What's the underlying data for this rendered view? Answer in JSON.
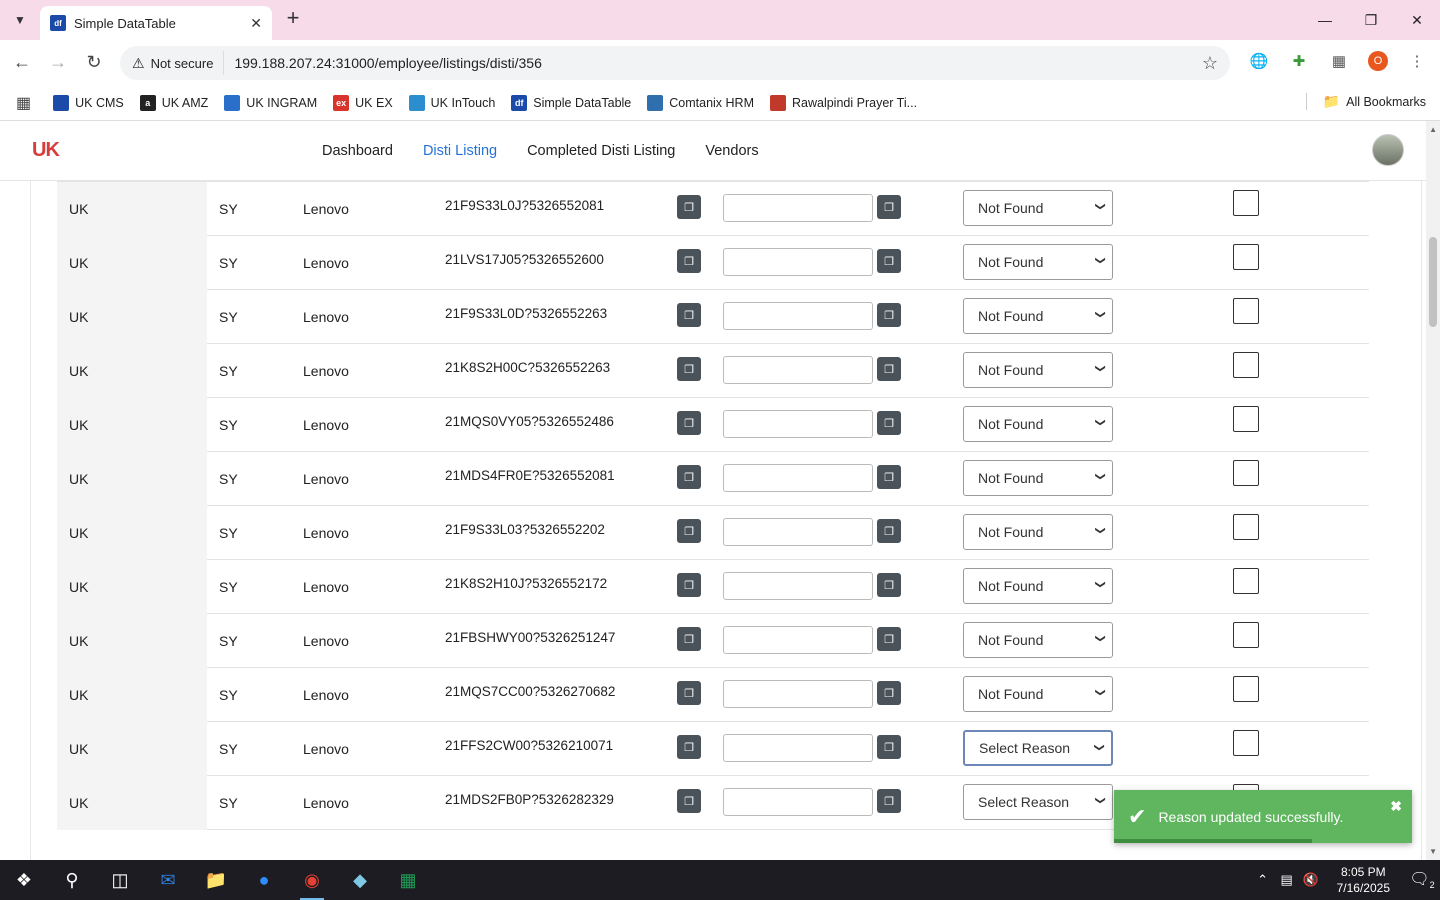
{
  "browser": {
    "tab_title": "Simple DataTable",
    "tab_favicon": "df",
    "not_secure": "Not secure",
    "url": "199.188.207.24:31000/employee/listings/disti/356",
    "profile_initial": "O",
    "bookmarks": [
      {
        "label": "UK CMS",
        "icon": "",
        "color": "#1b4aa8"
      },
      {
        "label": "UK AMZ",
        "icon": "a",
        "color": "#222222"
      },
      {
        "label": "UK INGRAM",
        "icon": "",
        "color": "#2a6fc9"
      },
      {
        "label": "UK EX",
        "icon": "ex",
        "color": "#d9342b"
      },
      {
        "label": "UK InTouch",
        "icon": "",
        "color": "#2c8ecf"
      },
      {
        "label": "Simple DataTable",
        "icon": "df",
        "color": "#1b4aa8"
      },
      {
        "label": "Comtanix HRM",
        "icon": "",
        "color": "#2f6fad"
      },
      {
        "label": "Rawalpindi Prayer Ti...",
        "icon": "",
        "color": "#c0392b"
      }
    ],
    "all_bookmarks": "All Bookmarks"
  },
  "site": {
    "logo_text": "UK",
    "nav": [
      "Dashboard",
      "Disti Listing",
      "Completed Disti Listing",
      "Vendors"
    ],
    "active_nav": "Disti Listing"
  },
  "rows": [
    {
      "country": "UK",
      "code": "SY",
      "brand": "Lenovo",
      "part": "21F9S33L0J?5326552081",
      "reason": "Not Found"
    },
    {
      "country": "UK",
      "code": "SY",
      "brand": "Lenovo",
      "part": "21LVS17J05?5326552600",
      "reason": "Not Found"
    },
    {
      "country": "UK",
      "code": "SY",
      "brand": "Lenovo",
      "part": "21F9S33L0D?5326552263",
      "reason": "Not Found"
    },
    {
      "country": "UK",
      "code": "SY",
      "brand": "Lenovo",
      "part": "21K8S2H00C?5326552263",
      "reason": "Not Found"
    },
    {
      "country": "UK",
      "code": "SY",
      "brand": "Lenovo",
      "part": "21MQS0VY05?5326552486",
      "reason": "Not Found"
    },
    {
      "country": "UK",
      "code": "SY",
      "brand": "Lenovo",
      "part": "21MDS4FR0E?5326552081",
      "reason": "Not Found"
    },
    {
      "country": "UK",
      "code": "SY",
      "brand": "Lenovo",
      "part": "21F9S33L03?5326552202",
      "reason": "Not Found"
    },
    {
      "country": "UK",
      "code": "SY",
      "brand": "Lenovo",
      "part": "21K8S2H10J?5326552172",
      "reason": "Not Found"
    },
    {
      "country": "UK",
      "code": "SY",
      "brand": "Lenovo",
      "part": "21FBSHWY00?5326251247",
      "reason": "Not Found"
    },
    {
      "country": "UK",
      "code": "SY",
      "brand": "Lenovo",
      "part": "21MQS7CC00?5326270682",
      "reason": "Not Found"
    },
    {
      "country": "UK",
      "code": "SY",
      "brand": "Lenovo",
      "part": "21FFS2CW00?5326210071",
      "reason": "Select Reason",
      "focused": true
    },
    {
      "country": "UK",
      "code": "SY",
      "brand": "Lenovo",
      "part": "21MDS2FB0P?5326282329",
      "reason": "Select Reason"
    }
  ],
  "toast": {
    "message": "Reason updated successfully.",
    "color": "#5fb65f"
  },
  "taskbar": {
    "time": "8:05 PM",
    "date": "7/16/2025",
    "notifications": "2"
  }
}
